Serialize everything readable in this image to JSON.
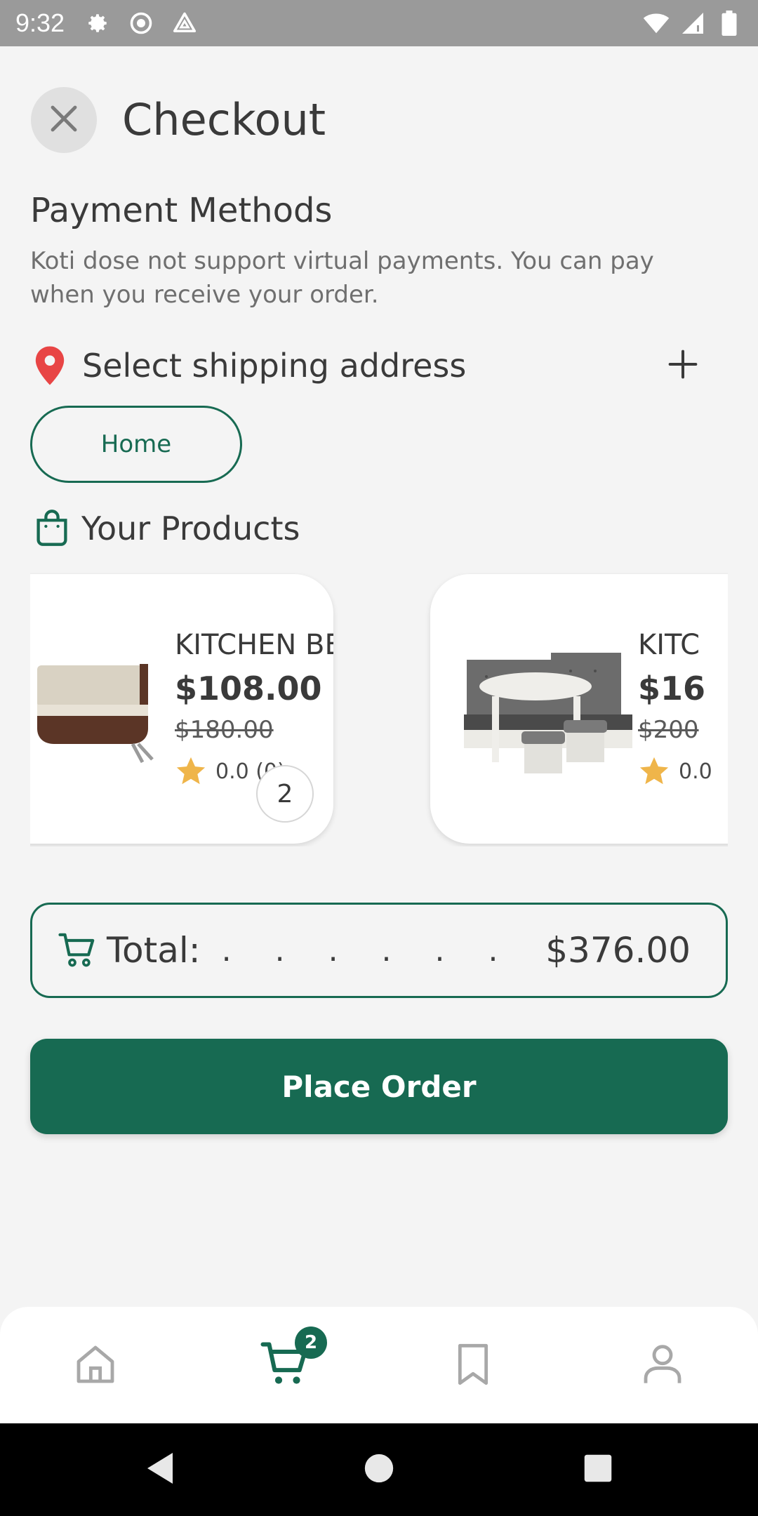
{
  "status_bar": {
    "time": "9:32",
    "icons_left": [
      "gear-icon",
      "record-icon",
      "drive-icon"
    ],
    "icons_right": [
      "wifi-icon",
      "signal-icon",
      "battery-icon"
    ]
  },
  "header": {
    "close_icon": "close-icon",
    "title": "Checkout"
  },
  "payment": {
    "title": "Payment Methods",
    "note": "Koti dose not support virtual payments. You can pay when you receive your order."
  },
  "shipping": {
    "label": "Select shipping address",
    "pin_icon": "location-pin-icon",
    "add_icon": "plus-icon",
    "selected_address": "Home"
  },
  "products": {
    "title": "Your Products",
    "icon": "shopping-bag-icon",
    "items": [
      {
        "name": "KITCHEN BENCH",
        "price": "$108.00",
        "old_price": "$180.00",
        "rating": "0.0 (0)",
        "quantity": "2"
      },
      {
        "name": "KITC",
        "price": "$16",
        "old_price": "$200",
        "rating": "0.0"
      }
    ]
  },
  "total": {
    "label": "Total:",
    "dots": ". . . . . . . . . .",
    "value": "$376.00",
    "icon": "cart-icon"
  },
  "actions": {
    "place_order": "Place Order"
  },
  "bottom_nav": {
    "items": [
      "home-icon",
      "cart-icon",
      "bookmark-icon",
      "profile-icon"
    ],
    "active": "cart",
    "cart_badge": "2"
  },
  "colors": {
    "brand": "#176a52",
    "background": "#f4f4f4",
    "pin": "#e84545",
    "star": "#efb54a"
  }
}
